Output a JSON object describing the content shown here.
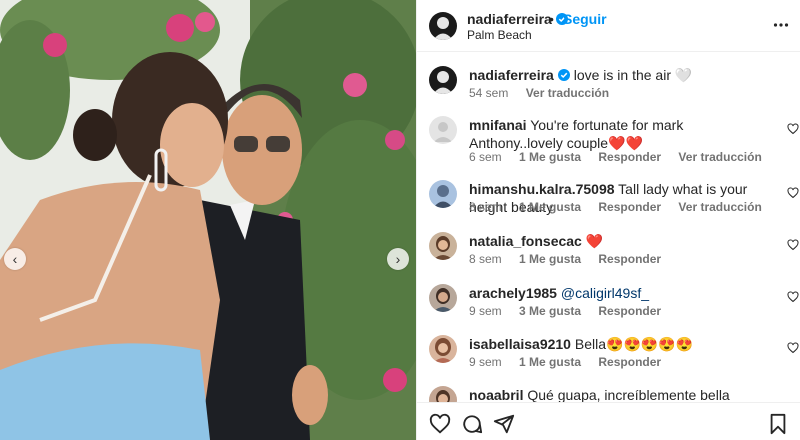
{
  "post": {
    "username": "nadiaferreira",
    "follow_label": "Seguir",
    "dot": "•",
    "location": "Palm Beach",
    "caption": "love is in the air 🤍",
    "caption_age": "54 sem",
    "caption_translate": "Ver traducción"
  },
  "comments": [
    {
      "user": "mnifanai",
      "text": "You're fortunate for mark Anthony..lovely couple❤️❤️",
      "age": "6 sem",
      "likes": "1 Me gusta",
      "reply": "Responder",
      "translate": "Ver traducción",
      "avatar_color": "#d9d9d9"
    },
    {
      "user": "himanshu.kalra.75098",
      "text": "Tall lady what is your height beauty",
      "age": "8 sem",
      "likes": "1 Me gusta",
      "reply": "Responder",
      "translate": "Ver traducción",
      "avatar_color": "#6b8ab8"
    },
    {
      "user": "natalia_fonsecac",
      "text": "❤️",
      "age": "8 sem",
      "likes": "1 Me gusta",
      "reply": "Responder",
      "avatar_color": "#7a5a3a"
    },
    {
      "user": "arachely1985",
      "mention": "@caligirl49sf_",
      "age": "9 sem",
      "likes": "3 Me gusta",
      "reply": "Responder",
      "avatar_color": "#a07d6a"
    },
    {
      "user": "isabellaisa9210",
      "text": "Bella😍😍😍😍😍",
      "age": "9 sem",
      "likes": "1 Me gusta",
      "reply": "Responder",
      "avatar_color": "#c08a6e"
    },
    {
      "user": "noaabril",
      "text": "Qué guapa, increíblemente bella",
      "avatar_color": "#8a6a55"
    }
  ],
  "icons": {
    "verified": "verified-badge-icon",
    "more": "more-options-icon",
    "heart": "heart-icon",
    "comment": "comment-icon",
    "share": "share-icon",
    "save": "bookmark-icon",
    "prev": "chevron-left-icon",
    "next": "chevron-right-icon"
  },
  "nav": {
    "prev": "‹",
    "next": "›"
  },
  "colors": {
    "link": "#0095f6",
    "muted": "#737373",
    "verified": "#0095f6"
  }
}
